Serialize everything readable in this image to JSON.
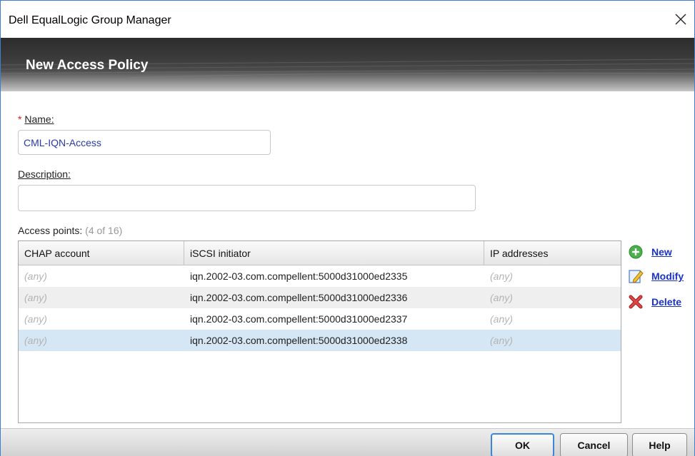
{
  "window": {
    "title": "Dell EqualLogic Group Manager"
  },
  "banner": {
    "heading": "New Access Policy"
  },
  "form": {
    "name_required_mark": "*",
    "name_label": "Name:",
    "name_value": "CML-IQN-Access",
    "description_label": "Description:",
    "description_value": "",
    "access_points_label": "Access points:",
    "access_points_count": "(4 of 16)"
  },
  "table": {
    "headers": [
      "CHAP account",
      "iSCSI initiator",
      "IP addresses"
    ],
    "rows": [
      {
        "chap": "(any)",
        "initiator": "iqn.2002-03.com.compellent:5000d31000ed2335",
        "ip": "(any)"
      },
      {
        "chap": "(any)",
        "initiator": "iqn.2002-03.com.compellent:5000d31000ed2336",
        "ip": "(any)"
      },
      {
        "chap": "(any)",
        "initiator": "iqn.2002-03.com.compellent:5000d31000ed2337",
        "ip": "(any)"
      },
      {
        "chap": "(any)",
        "initiator": "iqn.2002-03.com.compellent:5000d31000ed2338",
        "ip": "(any)"
      }
    ],
    "selected_row": 3
  },
  "actions": {
    "new_label": "New",
    "modify_label": "Modify",
    "delete_label": "Delete",
    "new_icon": "add-icon",
    "modify_icon": "edit-icon",
    "delete_icon": "delete-icon"
  },
  "footer": {
    "ok_label": "OK",
    "cancel_label": "Cancel",
    "help_label": "Help"
  },
  "colors": {
    "link": "#1a32c8",
    "required": "#d62020",
    "selection": "#d5e6f4",
    "focus_border": "#3b87d6"
  }
}
